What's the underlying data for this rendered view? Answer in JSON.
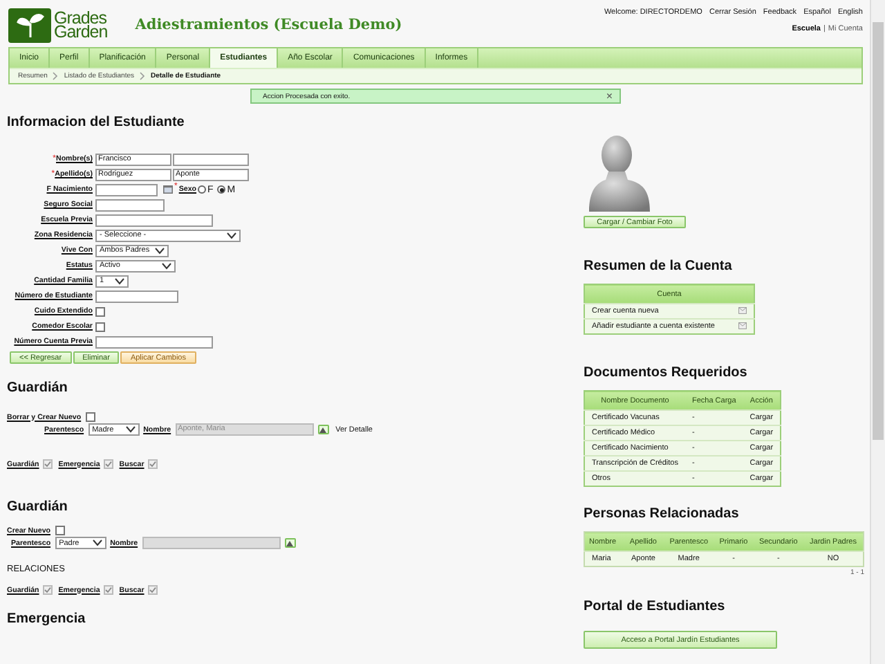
{
  "header": {
    "logo": [
      "Grades",
      "Garden"
    ],
    "title": "Adiestramientos (Escuela Demo)",
    "links": [
      "Welcome: DIRECTORDEMO",
      "Cerrar Sesión",
      "Feedback",
      "Español",
      "English"
    ],
    "separator": "|",
    "context": [
      {
        "label": "Escuela",
        "selected": true
      },
      {
        "label": "Mi Cuenta",
        "selected": false
      }
    ]
  },
  "tabs": [
    {
      "label": "Inicio",
      "selected": false
    },
    {
      "label": "Perfil",
      "selected": false
    },
    {
      "label": "Planificación",
      "selected": false
    },
    {
      "label": "Personal",
      "selected": false
    },
    {
      "label": "Estudiantes",
      "selected": true
    },
    {
      "label": "Año Escolar",
      "selected": false
    },
    {
      "label": "Comunicaciones",
      "selected": false
    },
    {
      "label": "Informes",
      "selected": false
    }
  ],
  "breadcrumb": [
    "Resumen",
    "Listado de Estudiantes",
    "Detalle de Estudiante"
  ],
  "message": {
    "text": "Accion Procesada con exito.",
    "close": "×"
  },
  "student": {
    "title": "Informacion del Estudiante",
    "fields": [
      {
        "kind": "pair",
        "label": "Nombre(s)",
        "required_mark": "*",
        "values": [
          "Francisco"
        ]
      },
      {
        "kind": "pair",
        "label": "Apellido(s)",
        "required_mark": "*",
        "values": [
          "Rodriguez",
          "Aponte"
        ]
      },
      {
        "kind": "date",
        "label": "F Nacimiento",
        "sex": {
          "label": "Sexo",
          "required_mark": "*",
          "options": [
            {
              "label": "F",
              "selected": false
            },
            {
              "label": "M",
              "selected": true
            }
          ]
        }
      },
      {
        "kind": "text",
        "label": "Seguro Social"
      },
      {
        "kind": "text",
        "label": "Escuela Previa"
      },
      {
        "kind": "select",
        "label": "Zona Residencia",
        "value": "- Seleccione -"
      },
      {
        "kind": "select",
        "label": "Vive Con",
        "value": "Ambos Padres"
      },
      {
        "kind": "select",
        "label": "Estatus",
        "value": "Activo"
      },
      {
        "kind": "select",
        "label": "Cantidad Familia",
        "value": "1"
      },
      {
        "kind": "text",
        "label": "Número de Estudiante"
      },
      {
        "kind": "checkbox",
        "label": "Cuido Extendido",
        "checked": false
      },
      {
        "kind": "checkbox",
        "label": "Comedor Escolar",
        "checked": false
      },
      {
        "kind": "text",
        "label": "Número Cuenta Previa"
      }
    ],
    "buttons": [
      {
        "label": "<< Regresar",
        "kind": "normal"
      },
      {
        "label": "Eliminar",
        "kind": "normal"
      },
      {
        "label": "Aplicar Cambios",
        "kind": "primary"
      }
    ]
  },
  "guardians": [
    {
      "title": "Guardián",
      "new_label": "Borrar y Crear Nuevo",
      "new_checked": false,
      "relation_label": "Parentesco",
      "relation": "Madre",
      "name_label": "Nombre",
      "name": "Aponte, Maria",
      "detail_link": "Ver Detalle",
      "flags": [
        {
          "label": "Guardián",
          "checked": true
        },
        {
          "label": "Emergencia",
          "checked": true
        },
        {
          "label": "Buscar",
          "checked": true
        }
      ]
    },
    {
      "title": "Guardián",
      "new_label": "Crear Nuevo",
      "new_checked": false,
      "relation_label": "Parentesco",
      "relation": "Padre",
      "name_label": "Nombre",
      "subheading": "RELACIONES",
      "flags": [
        {
          "label": "Guardián",
          "checked": true
        },
        {
          "label": "Emergencia",
          "checked": true
        },
        {
          "label": "Buscar",
          "checked": true
        }
      ]
    }
  ],
  "emergency": {
    "title": "Emergencia"
  },
  "photo_button": "Cargar / Cambiar Foto",
  "account": {
    "title": "Resumen de la Cuenta",
    "header": "Cuenta",
    "rows": [
      "Crear cuenta nueva",
      "Añadir estudiante a cuenta existente"
    ]
  },
  "documents": {
    "title": "Documentos Requeridos",
    "columns": [
      "Nombre Documento",
      "Fecha Carga",
      "Acción"
    ],
    "rows": [
      [
        "Certificado Vacunas",
        "-",
        "Cargar"
      ],
      [
        "Certificado Médico",
        "-",
        "Cargar"
      ],
      [
        "Certificado Nacimiento",
        "-",
        "Cargar"
      ],
      [
        "Transcripción de Créditos",
        "-",
        "Cargar"
      ],
      [
        "Otros",
        "-",
        "Cargar"
      ]
    ]
  },
  "related": {
    "title": "Personas Relacionadas",
    "columns": [
      "Nombre",
      "Apellido",
      "Parentesco",
      "Primario",
      "Secundario",
      "Jardin Padres"
    ],
    "rows": [
      [
        "Maria",
        "Aponte",
        "Madre",
        "-",
        "-",
        "NO"
      ]
    ],
    "pagination": "1 - 1"
  },
  "portal": {
    "title": "Portal de Estudiantes",
    "button": "Acceso a Portal Jardín Estudiantes"
  }
}
